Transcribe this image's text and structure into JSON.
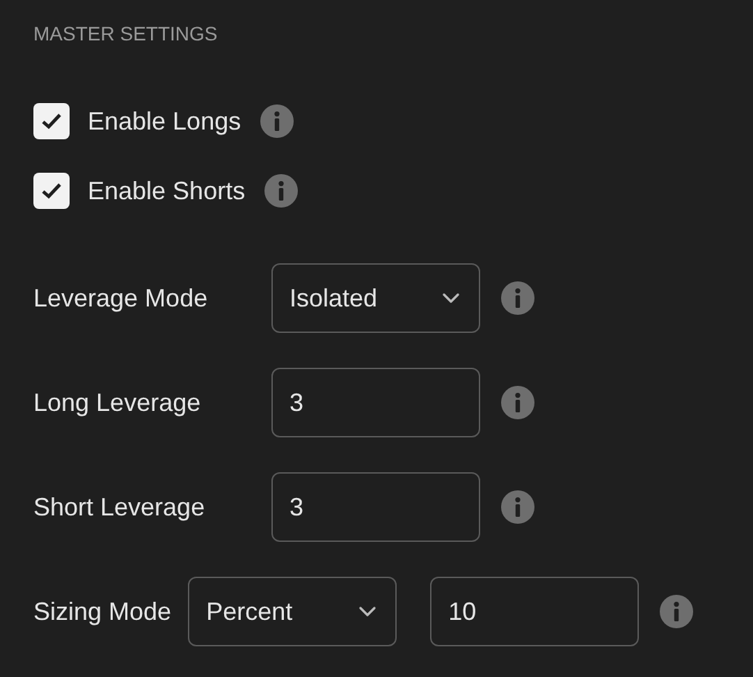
{
  "header": "MASTER SETTINGS",
  "toggles": [
    {
      "label": "Enable Longs",
      "checked": true
    },
    {
      "label": "Enable Shorts",
      "checked": true
    }
  ],
  "fields": [
    {
      "label": "Leverage Mode",
      "controls": [
        {
          "kind": "select",
          "value": "Isolated"
        }
      ]
    },
    {
      "label": "Long Leverage",
      "controls": [
        {
          "kind": "input",
          "value": "3"
        }
      ]
    },
    {
      "label": "Short Leverage",
      "controls": [
        {
          "kind": "input",
          "value": "3"
        }
      ]
    },
    {
      "label": "Sizing Mode",
      "controls": [
        {
          "kind": "select",
          "value": "Percent"
        },
        {
          "kind": "input",
          "value": "10"
        }
      ]
    }
  ]
}
